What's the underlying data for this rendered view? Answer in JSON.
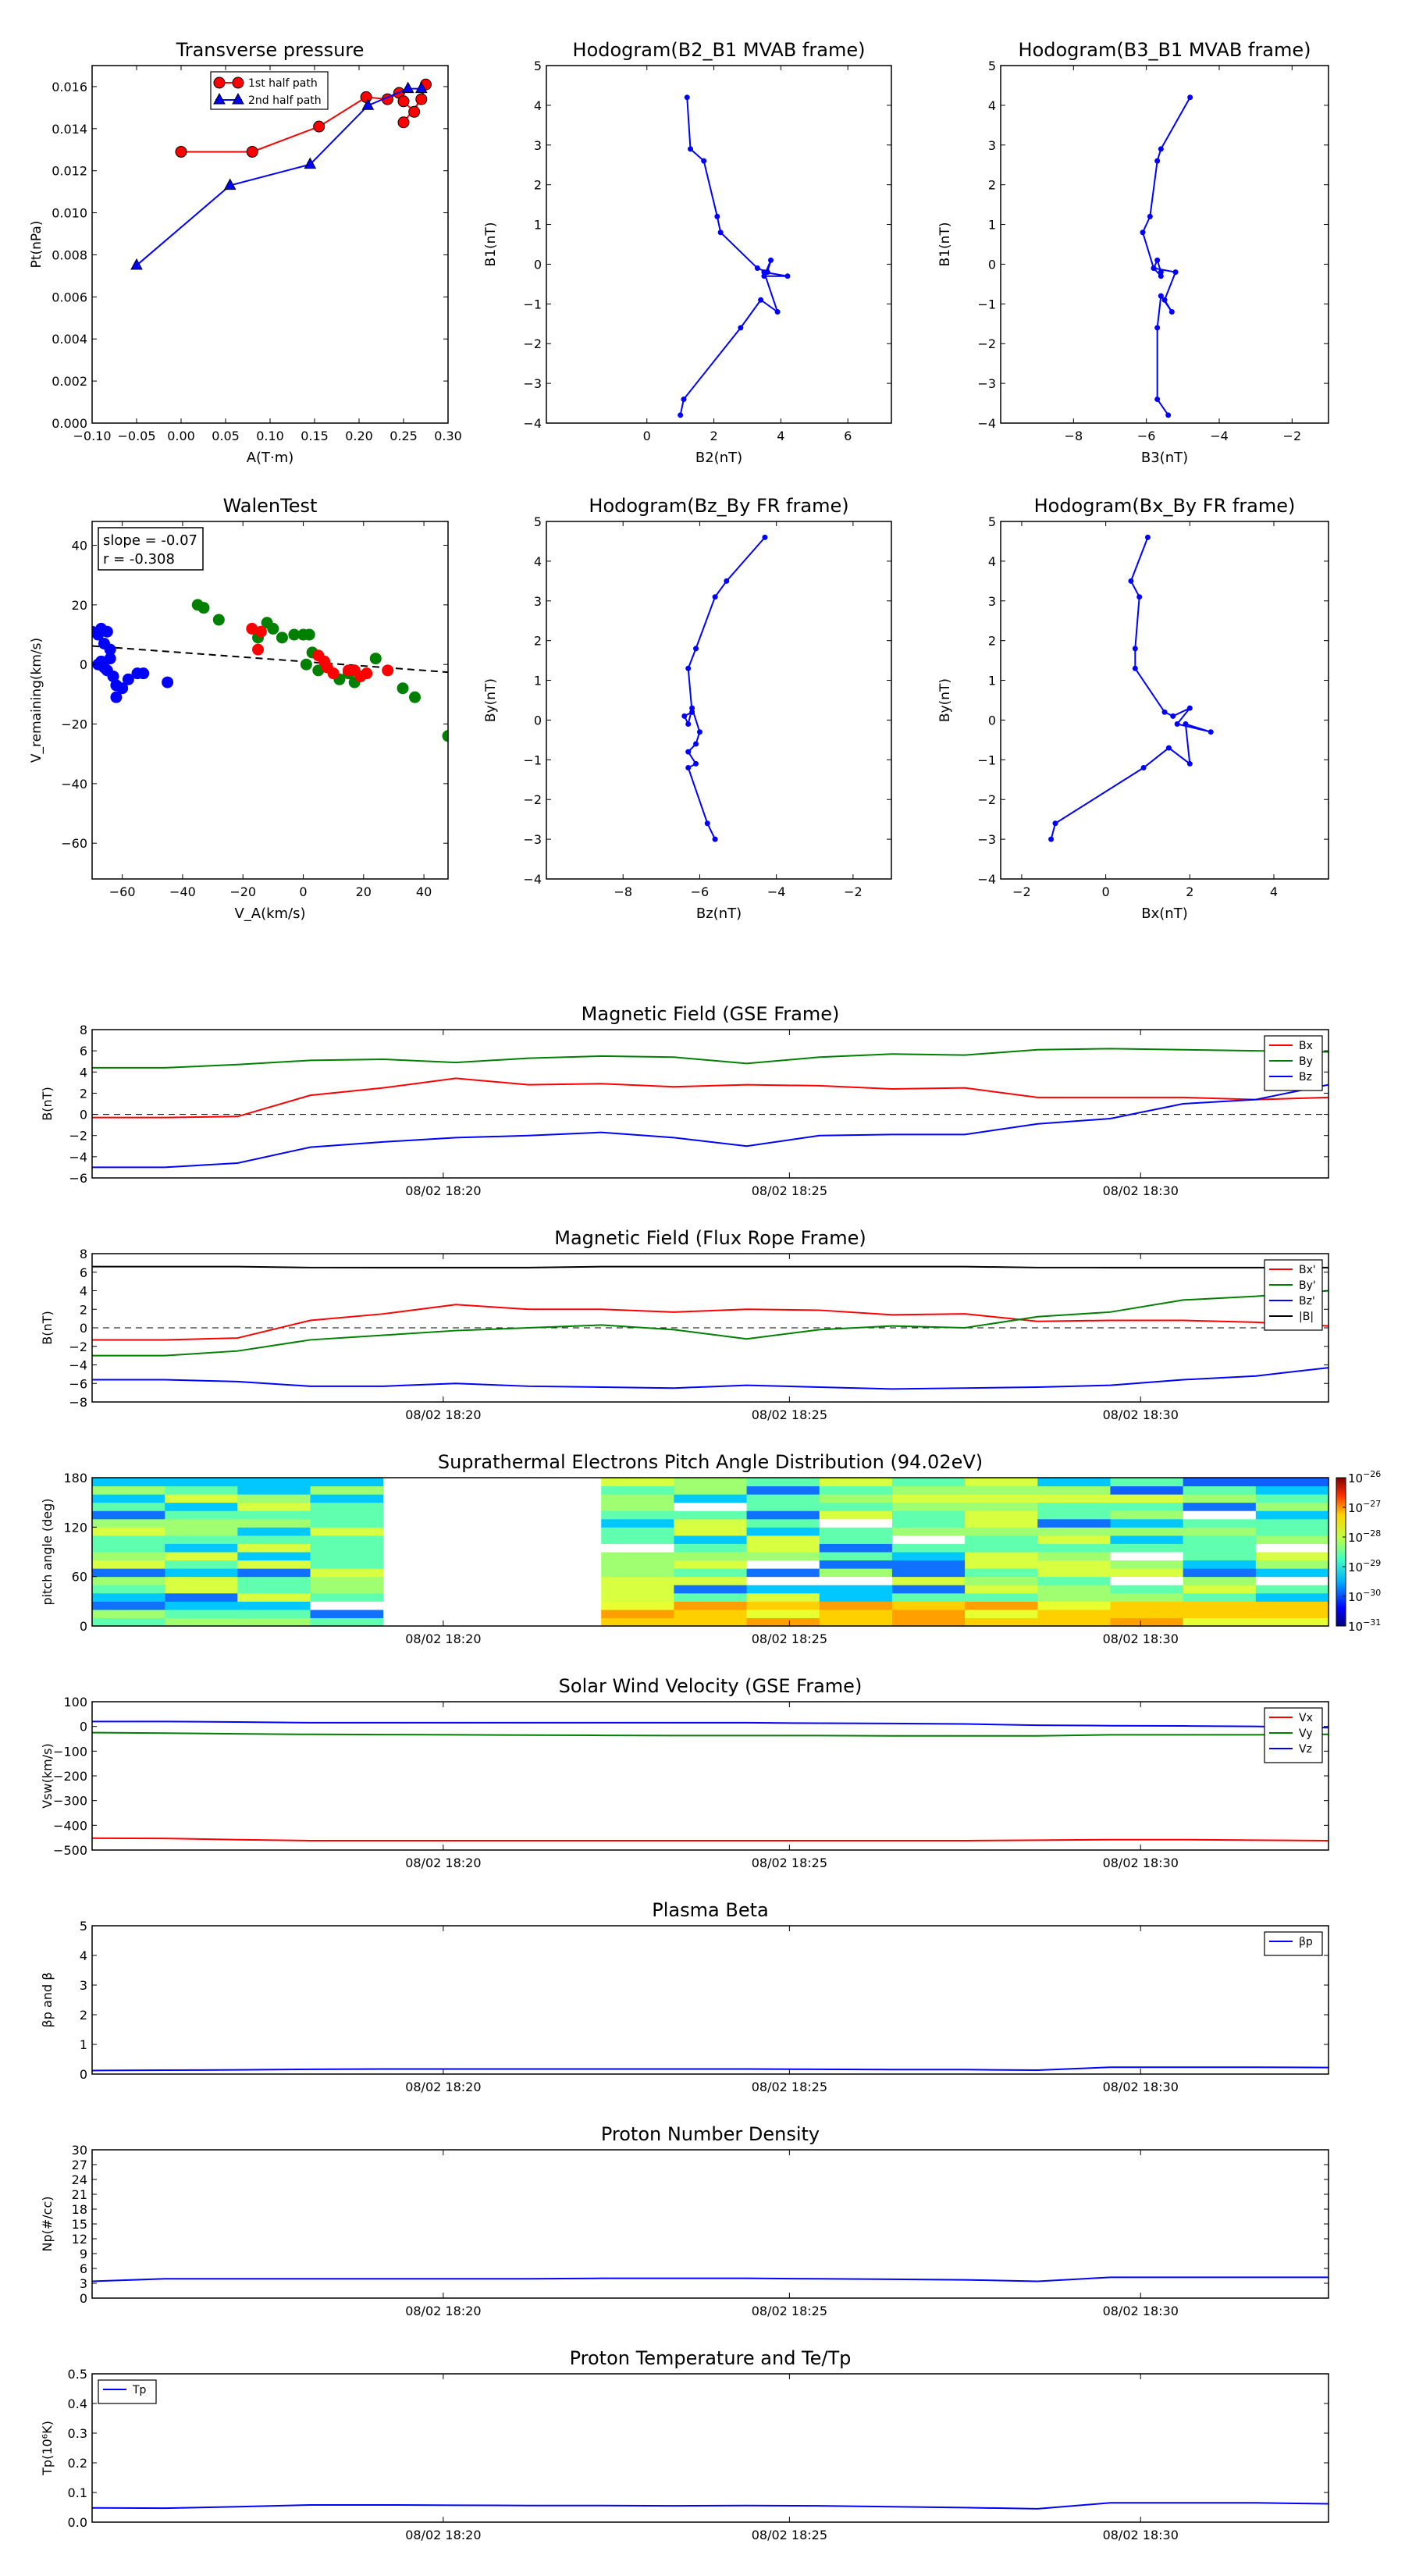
{
  "colors": {
    "red": "#ff0000",
    "green": "#008000",
    "blue": "#0000ff",
    "black": "#000000",
    "grid_dash": "#000000"
  },
  "chart_data": [
    {
      "id": "tp",
      "type": "scatter",
      "title": "Transverse pressure",
      "xlabel": "A(T·m)",
      "ylabel": "Pt(nPa)",
      "xlim": [
        -0.1,
        0.3
      ],
      "ylim": [
        0,
        0.017
      ],
      "xticks": [
        "-0.10",
        "-0.05",
        "0.00",
        "0.05",
        "0.10",
        "0.15",
        "0.20",
        "0.25",
        "0.30"
      ],
      "yticks": [
        "0.000",
        "0.002",
        "0.004",
        "0.006",
        "0.008",
        "0.010",
        "0.012",
        "0.014",
        "0.016"
      ],
      "legend": "top-center",
      "series": [
        {
          "name": "1st half path",
          "marker": "circle",
          "color": "red",
          "x": [
            0.0,
            0.08,
            0.155,
            0.208,
            0.232,
            0.245,
            0.25,
            0.262,
            0.275,
            0.27,
            0.25
          ],
          "y": [
            0.0129,
            0.0129,
            0.0141,
            0.0155,
            0.0154,
            0.0157,
            0.0153,
            0.0148,
            0.0161,
            0.0154,
            0.0143
          ]
        },
        {
          "name": "2nd half path",
          "marker": "triangle",
          "color": "blue",
          "x": [
            -0.05,
            0.055,
            0.145,
            0.21,
            0.255,
            0.27
          ],
          "y": [
            0.0075,
            0.0113,
            0.0123,
            0.0151,
            0.0159,
            0.0159
          ]
        }
      ]
    },
    {
      "id": "h1",
      "type": "line",
      "title": "Hodogram(B2_B1 MVAB frame)",
      "xlabel": "B2(nT)",
      "ylabel": "B1(nT)",
      "xlim": [
        -3,
        7.3
      ],
      "ylim": [
        -4,
        5
      ],
      "xticks": [
        "0",
        "2",
        "4",
        "6"
      ],
      "yticks": [
        "-4",
        "-3",
        "-2",
        "-1",
        "0",
        "1",
        "2",
        "3",
        "4",
        "5"
      ],
      "series": [
        {
          "color": "blue",
          "x": [
            1.2,
            1.3,
            1.7,
            2.1,
            2.2,
            3.3,
            3.6,
            3.7,
            3.5,
            4.2,
            3.5,
            3.9,
            3.4,
            2.8,
            1.1,
            1.0
          ],
          "y": [
            4.2,
            2.9,
            2.6,
            1.2,
            0.8,
            -0.1,
            -0.2,
            0.1,
            -0.3,
            -0.3,
            -0.2,
            -1.2,
            -0.9,
            -1.6,
            -3.4,
            -3.8
          ]
        }
      ]
    },
    {
      "id": "h2",
      "type": "line",
      "title": "Hodogram(B3_B1 MVAB frame)",
      "xlabel": "B3(nT)",
      "ylabel": "B1(nT)",
      "xlim": [
        -10,
        -1
      ],
      "ylim": [
        -4,
        5
      ],
      "xticks": [
        "-8",
        "-6",
        "-4",
        "-2"
      ],
      "yticks": [
        "-4",
        "-3",
        "-2",
        "-1",
        "0",
        "1",
        "2",
        "3",
        "4",
        "5"
      ],
      "series": [
        {
          "color": "blue",
          "x": [
            -4.8,
            -5.6,
            -5.7,
            -5.9,
            -6.1,
            -5.8,
            -5.7,
            -5.6,
            -5.6,
            -5.8,
            -5.2,
            -5.5,
            -5.3,
            -5.6,
            -5.7,
            -5.7,
            -5.4
          ],
          "y": [
            4.2,
            2.9,
            2.6,
            1.2,
            0.8,
            -0.1,
            0.1,
            -0.2,
            -0.3,
            -0.1,
            -0.2,
            -0.9,
            -1.2,
            -0.8,
            -1.6,
            -3.4,
            -3.8
          ]
        }
      ]
    },
    {
      "id": "walen",
      "type": "scatter",
      "title": "WalenTest",
      "xlabel": "V_A(km/s)",
      "ylabel": "V_remaining(km/s)",
      "xlim": [
        -70,
        48
      ],
      "ylim": [
        -72,
        48
      ],
      "xticks": [
        "-60",
        "-40",
        "-20",
        "0",
        "20",
        "40"
      ],
      "yticks": [
        "-60",
        "-40",
        "-20",
        "0",
        "20",
        "40"
      ],
      "annotation": [
        "slope = -0.07",
        "r = -0.308"
      ],
      "fit_line": {
        "x": [
          -70,
          48
        ],
        "y": [
          6.2,
          -2.6
        ]
      },
      "series": [
        {
          "color": "blue",
          "x": [
            -70,
            -68,
            -67,
            -65,
            -66,
            -64,
            -65,
            -63,
            -62,
            -60,
            -58,
            -55,
            -53,
            -45,
            -67,
            -66,
            -68,
            -64,
            -62
          ],
          "y": [
            11,
            10,
            12,
            11,
            7,
            5,
            -2,
            -4,
            -11,
            -8,
            -5,
            -3,
            -3,
            -6,
            1,
            -1,
            0,
            2,
            -7
          ]
        },
        {
          "color": "green",
          "x": [
            -35,
            -33,
            -28,
            -15,
            -12,
            -10,
            -7,
            -3,
            0,
            2,
            1,
            3,
            5,
            12,
            15,
            17,
            24,
            33,
            37,
            48
          ],
          "y": [
            20,
            19,
            15,
            9,
            14,
            12,
            9,
            10,
            10,
            10,
            0,
            4,
            -2,
            -5,
            -3,
            -6,
            2,
            -8,
            -11,
            -24
          ]
        },
        {
          "color": "red",
          "x": [
            -17,
            -14,
            -15,
            5,
            7,
            8,
            10,
            15,
            17,
            19,
            21,
            28
          ],
          "y": [
            12,
            11,
            5,
            3,
            1,
            -1,
            -3,
            -2,
            -2,
            -4,
            -3,
            -2
          ]
        }
      ]
    },
    {
      "id": "h3",
      "type": "line",
      "title": "Hodogram(Bz_By FR frame)",
      "xlabel": "Bz(nT)",
      "ylabel": "By(nT)",
      "xlim": [
        -10,
        -1
      ],
      "ylim": [
        -4,
        5
      ],
      "xticks": [
        "-8",
        "-6",
        "-4",
        "-2"
      ],
      "yticks": [
        "-4",
        "-3",
        "-2",
        "-1",
        "0",
        "1",
        "2",
        "3",
        "4",
        "5"
      ],
      "series": [
        {
          "color": "blue",
          "x": [
            -4.3,
            -5.3,
            -5.6,
            -6.1,
            -6.3,
            -6.2,
            -6.4,
            -6.3,
            -6.2,
            -6.0,
            -6.1,
            -6.3,
            -6.1,
            -6.3,
            -5.8,
            -5.6
          ],
          "y": [
            4.6,
            3.5,
            3.1,
            1.8,
            1.3,
            0.2,
            0.1,
            -0.1,
            0.3,
            -0.3,
            -0.6,
            -0.8,
            -1.1,
            -1.2,
            -2.6,
            -3.0
          ]
        }
      ]
    },
    {
      "id": "h4",
      "type": "line",
      "title": "Hodogram(Bx_By FR frame)",
      "xlabel": "Bx(nT)",
      "ylabel": "By(nT)",
      "xlim": [
        -2.5,
        5.3
      ],
      "ylim": [
        -4,
        5
      ],
      "xticks": [
        "-2",
        "0",
        "2",
        "4"
      ],
      "yticks": [
        "-4",
        "-3",
        "-2",
        "-1",
        "0",
        "1",
        "2",
        "3",
        "4",
        "5"
      ],
      "series": [
        {
          "color": "blue",
          "x": [
            1.0,
            0.6,
            0.8,
            0.7,
            0.7,
            1.4,
            1.6,
            2.0,
            1.7,
            2.5,
            1.9,
            2.0,
            1.5,
            0.9,
            -1.2,
            -1.3
          ],
          "y": [
            4.6,
            3.5,
            3.1,
            1.8,
            1.3,
            0.2,
            0.1,
            0.3,
            -0.1,
            -0.3,
            -0.1,
            -1.1,
            -0.7,
            -1.2,
            -2.6,
            -3.0
          ]
        }
      ]
    },
    {
      "id": "mf_gse",
      "type": "line",
      "title": "Magnetic Field (GSE Frame)",
      "ylabel": "B(nT)",
      "ylim": [
        -6,
        8
      ],
      "yticks": [
        "-6",
        "-4",
        "-2",
        "0",
        "2",
        "4",
        "6",
        "8"
      ],
      "xticklabels": [
        "08/02 18:20",
        "08/02 18:25",
        "08/02 18:30"
      ],
      "legend": "top-right",
      "zero_line": true,
      "x": [
        0,
        1,
        2,
        3,
        4,
        5,
        6,
        7,
        8,
        9,
        10,
        11,
        12,
        13,
        14,
        15,
        16,
        17
      ],
      "series": [
        {
          "name": "Bx",
          "color": "red",
          "values": [
            -0.3,
            -0.3,
            -0.2,
            1.8,
            2.5,
            3.4,
            2.8,
            2.9,
            2.6,
            2.8,
            2.7,
            2.4,
            2.5,
            1.6,
            1.6,
            1.6,
            1.4,
            1.6
          ]
        },
        {
          "name": "By",
          "color": "green",
          "values": [
            4.4,
            4.4,
            4.7,
            5.1,
            5.2,
            4.9,
            5.3,
            5.5,
            5.4,
            4.8,
            5.4,
            5.7,
            5.6,
            6.1,
            6.2,
            6.1,
            6.0,
            5.9
          ]
        },
        {
          "name": "Bz",
          "color": "blue",
          "values": [
            -5.0,
            -5.0,
            -4.6,
            -3.1,
            -2.6,
            -2.2,
            -2.0,
            -1.7,
            -2.2,
            -3.0,
            -2.0,
            -1.9,
            -1.9,
            -0.9,
            -0.4,
            1.0,
            1.4,
            2.8
          ]
        }
      ]
    },
    {
      "id": "mf_fr",
      "type": "line",
      "title": "Magnetic Field (Flux Rope Frame)",
      "ylabel": "B(nT)",
      "ylim": [
        -8,
        8
      ],
      "yticks": [
        "-8",
        "-6",
        "-4",
        "-2",
        "0",
        "2",
        "4",
        "6",
        "8"
      ],
      "xticklabels": [
        "08/02 18:20",
        "08/02 18:25",
        "08/02 18:30"
      ],
      "legend": "top-right",
      "zero_line": true,
      "x": [
        0,
        1,
        2,
        3,
        4,
        5,
        6,
        7,
        8,
        9,
        10,
        11,
        12,
        13,
        14,
        15,
        16,
        17
      ],
      "series": [
        {
          "name": "Bx'",
          "color": "red",
          "values": [
            -1.3,
            -1.3,
            -1.1,
            0.8,
            1.5,
            2.5,
            2.0,
            2.0,
            1.7,
            2.0,
            1.9,
            1.4,
            1.5,
            0.7,
            0.8,
            0.8,
            0.6,
            0.2
          ]
        },
        {
          "name": "By'",
          "color": "green",
          "values": [
            -3.0,
            -3.0,
            -2.5,
            -1.3,
            -0.8,
            -0.3,
            0.0,
            0.3,
            -0.2,
            -1.2,
            -0.2,
            0.2,
            0.0,
            1.2,
            1.7,
            3.0,
            3.4,
            4.0
          ]
        },
        {
          "name": "Bz'",
          "color": "blue",
          "values": [
            -5.6,
            -5.6,
            -5.8,
            -6.3,
            -6.3,
            -6.0,
            -6.3,
            -6.4,
            -6.5,
            -6.2,
            -6.4,
            -6.6,
            -6.5,
            -6.4,
            -6.2,
            -5.6,
            -5.2,
            -4.3
          ]
        },
        {
          "name": "|B|",
          "color": "black",
          "values": [
            6.6,
            6.6,
            6.6,
            6.5,
            6.5,
            6.5,
            6.5,
            6.6,
            6.6,
            6.6,
            6.6,
            6.6,
            6.6,
            6.5,
            6.5,
            6.5,
            6.5,
            6.5
          ]
        }
      ]
    },
    {
      "id": "pad",
      "type": "heatmap",
      "title": "Suprathermal Electrons Pitch Angle Distribution (94.02eV)",
      "ylabel": "pitch angle (deg)",
      "ylim": [
        0,
        180
      ],
      "yticks": [
        "0",
        "60",
        "120",
        "180"
      ],
      "xticklabels": [
        "08/02 18:20",
        "08/02 18:25",
        "08/02 18:30"
      ],
      "colorbar_exponents": [
        "-26",
        "-27",
        "-28",
        "-29",
        "-30",
        "-31"
      ],
      "colorbar_base": "10",
      "columns": 17,
      "rows": 18,
      "gap_columns": [
        4,
        5,
        6
      ]
    },
    {
      "id": "vsw",
      "type": "line",
      "title": "Solar Wind Velocity (GSE Frame)",
      "ylabel": "Vsw(km/s)",
      "ylim": [
        -500,
        100
      ],
      "yticks": [
        "-500",
        "-400",
        "-300",
        "-200",
        "-100",
        "0",
        "100"
      ],
      "xticklabels": [
        "08/02 18:20",
        "08/02 18:25",
        "08/02 18:30"
      ],
      "legend": "top-right",
      "x": [
        0,
        1,
        2,
        3,
        4,
        5,
        6,
        7,
        8,
        9,
        10,
        11,
        12,
        13,
        14,
        15,
        16,
        17
      ],
      "series": [
        {
          "name": "Vx",
          "color": "red",
          "values": [
            -452,
            -453,
            -458,
            -462,
            -462,
            -462,
            -462,
            -462,
            -462,
            -462,
            -462,
            -462,
            -462,
            -460,
            -458,
            -458,
            -460,
            -462
          ]
        },
        {
          "name": "Vy",
          "color": "green",
          "values": [
            -25,
            -27,
            -30,
            -32,
            -33,
            -34,
            -35,
            -36,
            -37,
            -37,
            -37,
            -38,
            -38,
            -38,
            -34,
            -34,
            -34,
            -32
          ]
        },
        {
          "name": "Vz",
          "color": "blue",
          "values": [
            20,
            20,
            18,
            15,
            15,
            15,
            15,
            15,
            15,
            15,
            13,
            12,
            10,
            5,
            3,
            2,
            0,
            -5
          ]
        }
      ]
    },
    {
      "id": "beta",
      "type": "line",
      "title": "Plasma Beta",
      "ylabel": "βp and β",
      "ylim": [
        0,
        5
      ],
      "yticks": [
        "0",
        "1",
        "2",
        "3",
        "4",
        "5"
      ],
      "xticklabels": [
        "08/02 18:20",
        "08/02 18:25",
        "08/02 18:30"
      ],
      "legend": "top-right",
      "x": [
        0,
        1,
        2,
        3,
        4,
        5,
        6,
        7,
        8,
        9,
        10,
        11,
        12,
        13,
        14,
        15,
        16,
        17
      ],
      "series": [
        {
          "name": "βp",
          "color": "blue",
          "values": [
            0.12,
            0.13,
            0.14,
            0.16,
            0.17,
            0.17,
            0.17,
            0.17,
            0.17,
            0.17,
            0.16,
            0.15,
            0.15,
            0.13,
            0.23,
            0.23,
            0.23,
            0.22
          ]
        }
      ]
    },
    {
      "id": "np",
      "type": "line",
      "title": "Proton Number Density",
      "ylabel": "Np(#/cc)",
      "ylim": [
        0,
        30
      ],
      "yticks": [
        "0",
        "3",
        "6",
        "9",
        "12",
        "15",
        "18",
        "21",
        "24",
        "27",
        "30"
      ],
      "xticklabels": [
        "08/02 18:20",
        "08/02 18:25",
        "08/02 18:30"
      ],
      "x": [
        0,
        1,
        2,
        3,
        4,
        5,
        6,
        7,
        8,
        9,
        10,
        11,
        12,
        13,
        14,
        15,
        16,
        17
      ],
      "series": [
        {
          "color": "blue",
          "values": [
            3.4,
            3.9,
            3.9,
            3.9,
            3.9,
            3.9,
            3.9,
            4.0,
            4.0,
            4.0,
            3.9,
            3.8,
            3.7,
            3.4,
            4.2,
            4.2,
            4.2,
            4.2
          ]
        }
      ]
    },
    {
      "id": "tp_temp",
      "type": "line",
      "title": "Proton Temperature and Te/Tp",
      "ylabel": "Tp(10⁶K)",
      "ylim": [
        0,
        0.5
      ],
      "yticks": [
        "0.0",
        "0.1",
        "0.2",
        "0.3",
        "0.4",
        "0.5"
      ],
      "xticklabels": [
        "08/02 18:20",
        "08/02 18:25",
        "08/02 18:30"
      ],
      "legend": "top-left",
      "x": [
        0,
        1,
        2,
        3,
        4,
        5,
        6,
        7,
        8,
        9,
        10,
        11,
        12,
        13,
        14,
        15,
        16,
        17
      ],
      "series": [
        {
          "name": "Tp",
          "color": "blue",
          "values": [
            0.048,
            0.047,
            0.052,
            0.058,
            0.058,
            0.057,
            0.056,
            0.056,
            0.055,
            0.056,
            0.055,
            0.052,
            0.049,
            0.045,
            0.065,
            0.065,
            0.065,
            0.062
          ]
        }
      ]
    }
  ]
}
